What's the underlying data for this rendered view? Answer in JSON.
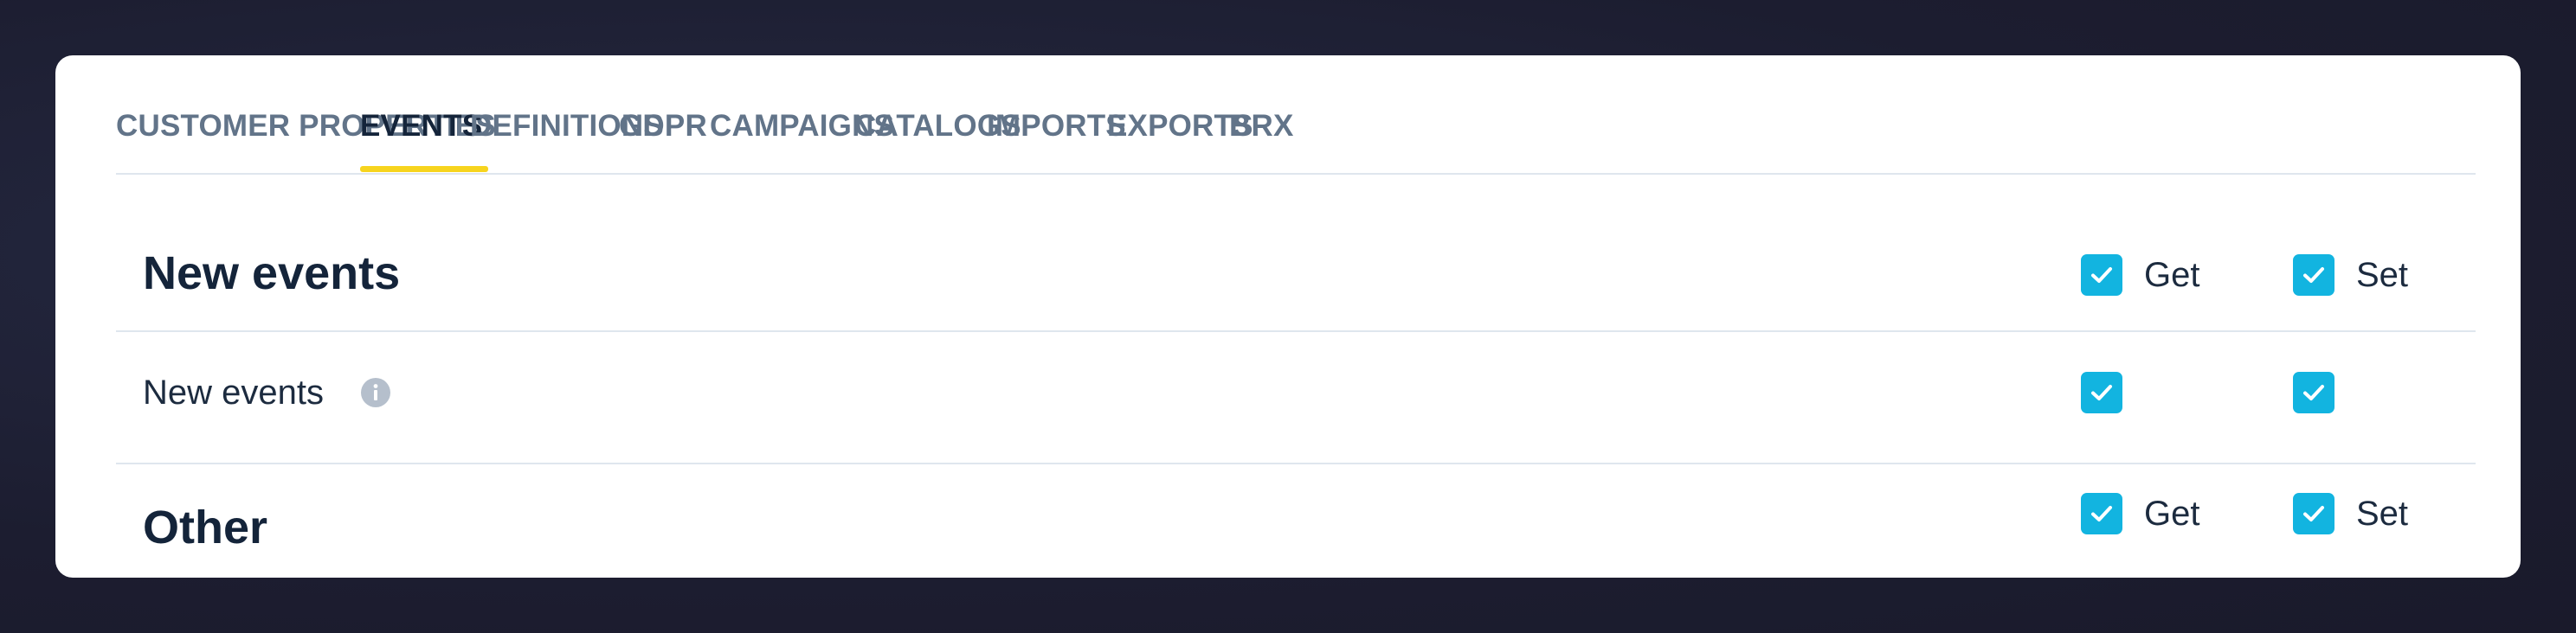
{
  "tabs": [
    {
      "label": "CUSTOMER PROPERTIES",
      "active": false
    },
    {
      "label": "EVENTS",
      "active": true
    },
    {
      "label": "DEFINITIONS",
      "active": false
    },
    {
      "label": "GDPR",
      "active": false
    },
    {
      "label": "CAMPAIGNS",
      "active": false
    },
    {
      "label": "CATALOGS",
      "active": false
    },
    {
      "label": "IMPORTS",
      "active": false
    },
    {
      "label": "EXPORTS",
      "active": false
    },
    {
      "label": "BRX",
      "active": false
    }
  ],
  "sections": [
    {
      "title": "New events",
      "get_label": "Get",
      "set_label": "Set",
      "get_checked": true,
      "set_checked": true,
      "rows": [
        {
          "label": "New events",
          "has_info": true,
          "get_checked": true,
          "set_checked": true
        }
      ]
    },
    {
      "title": "Other",
      "get_label": "Get",
      "set_label": "Set",
      "get_checked": true,
      "set_checked": true
    }
  ],
  "colors": {
    "accent_checkbox": "#12b4e0",
    "active_tab_underline": "#f7d41e",
    "tab_text": "#627489",
    "active_tab_text": "#14243a"
  }
}
